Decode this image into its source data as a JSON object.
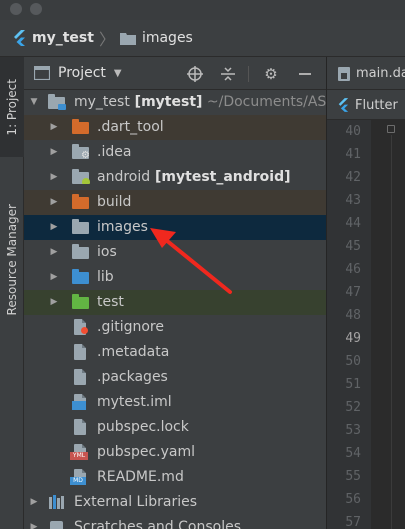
{
  "breadcrumb": {
    "project": "my_test",
    "folder": "images"
  },
  "sidebar_tabs": {
    "project": "1: Project",
    "resource_manager": "Resource Manager"
  },
  "panel": {
    "title": "Project",
    "icons": [
      "locate-icon",
      "collapse-icon",
      "settings-icon",
      "hide-icon"
    ]
  },
  "tree": [
    {
      "name": "my_test",
      "extra": "[mytest]",
      "muted": "~/Documents/ASP",
      "depth": 0,
      "expanded": true,
      "icon": "module-folder",
      "highlight": "none"
    },
    {
      "name": ".dart_tool",
      "depth": 1,
      "expanded": false,
      "icon": "folder-orange",
      "highlight": "excluded"
    },
    {
      "name": ".idea",
      "depth": 1,
      "expanded": false,
      "icon": "folder-gear",
      "highlight": "none"
    },
    {
      "name": "android",
      "extra": "[mytest_android]",
      "depth": 1,
      "expanded": false,
      "icon": "folder-android",
      "highlight": "none"
    },
    {
      "name": "build",
      "depth": 1,
      "expanded": false,
      "icon": "folder-orange",
      "highlight": "excluded"
    },
    {
      "name": "images",
      "depth": 1,
      "expanded": false,
      "icon": "folder",
      "highlight": "selected"
    },
    {
      "name": "ios",
      "depth": 1,
      "expanded": false,
      "icon": "folder",
      "highlight": "none"
    },
    {
      "name": "lib",
      "depth": 1,
      "expanded": false,
      "icon": "folder-blue",
      "highlight": "none"
    },
    {
      "name": "test",
      "depth": 1,
      "expanded": false,
      "icon": "folder-green",
      "highlight": "test"
    },
    {
      "name": ".gitignore",
      "depth": 1,
      "icon": "file-git",
      "highlight": "none"
    },
    {
      "name": ".metadata",
      "depth": 1,
      "icon": "file",
      "highlight": "none"
    },
    {
      "name": ".packages",
      "depth": 1,
      "icon": "file",
      "highlight": "none"
    },
    {
      "name": "mytest.iml",
      "depth": 1,
      "icon": "file-iml",
      "highlight": "none"
    },
    {
      "name": "pubspec.lock",
      "depth": 1,
      "icon": "file",
      "highlight": "none"
    },
    {
      "name": "pubspec.yaml",
      "depth": 1,
      "icon": "file-yaml",
      "highlight": "none"
    },
    {
      "name": "README.md",
      "depth": 1,
      "icon": "file-md",
      "highlight": "none"
    },
    {
      "name": "External Libraries",
      "depth": 0,
      "expanded": false,
      "icon": "libraries",
      "highlight": "none"
    },
    {
      "name": "Scratches and Consoles",
      "depth": 0,
      "expanded": false,
      "icon": "scratches",
      "highlight": "none"
    }
  ],
  "editor": {
    "tabs": [
      "main.da",
      "Flutter"
    ],
    "line_numbers": [
      "40",
      "41",
      "42",
      "43",
      "44",
      "45",
      "46",
      "47",
      "48",
      "49",
      "50",
      "51",
      "52",
      "53",
      "54",
      "55",
      "56",
      "57"
    ],
    "current_line": "49"
  },
  "colors": {
    "selected_row": "#0d293e",
    "excluded_row": "#3f3a33",
    "test_row": "#37412f",
    "annotation_arrow": "#f0281e"
  }
}
